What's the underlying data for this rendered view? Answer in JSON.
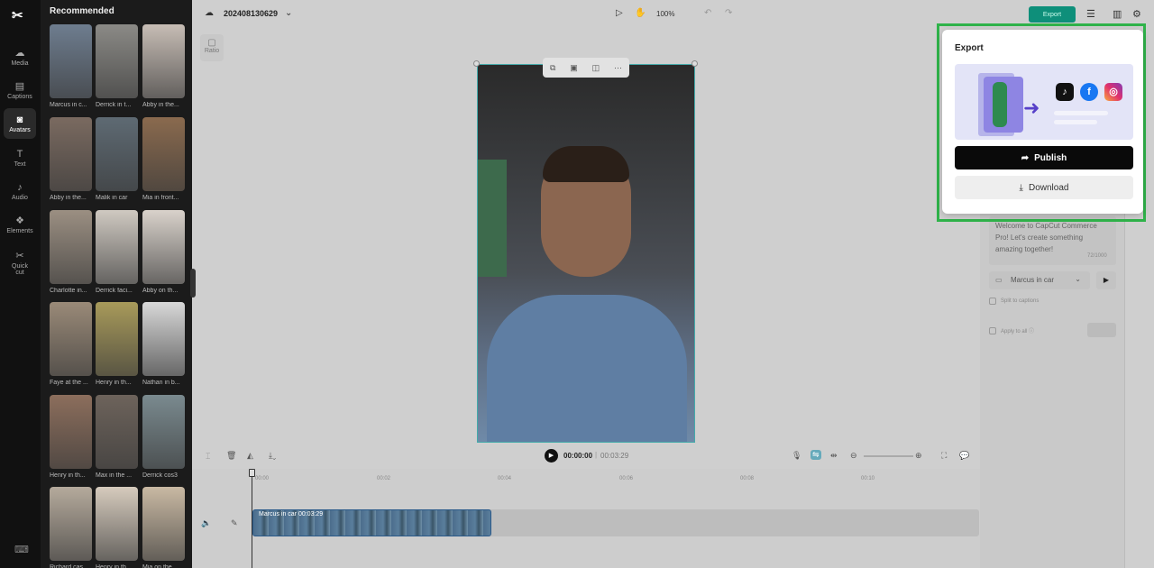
{
  "app": {
    "logo": "✂"
  },
  "rail": {
    "items": [
      {
        "label": "Media",
        "icon": "media-icon",
        "glyph": "☁"
      },
      {
        "label": "Captions",
        "icon": "captions-icon",
        "glyph": "▤"
      },
      {
        "label": "Avatars",
        "icon": "avatars-icon",
        "glyph": "◙"
      },
      {
        "label": "Text",
        "icon": "text-icon",
        "glyph": "T"
      },
      {
        "label": "Audio",
        "icon": "audio-icon",
        "glyph": "♪"
      },
      {
        "label": "Elements",
        "icon": "elements-icon",
        "glyph": "❖"
      },
      {
        "label": "Quick cut",
        "icon": "quick-cut-icon",
        "glyph": "✂"
      }
    ]
  },
  "panel": {
    "title": "Recommended",
    "avatars": [
      {
        "label": "Marcus in c...",
        "color": "#6e7d8f"
      },
      {
        "label": "Derrick in t...",
        "color": "#8b8a86"
      },
      {
        "label": "Abby in the...",
        "color": "#c7bdb5"
      },
      {
        "label": "Abby in the...",
        "color": "#7a6a60"
      },
      {
        "label": "Malik in car",
        "color": "#5e6a73"
      },
      {
        "label": "Mia in front...",
        "color": "#8a6a4e"
      },
      {
        "label": "Charlotte in...",
        "color": "#9b8f82"
      },
      {
        "label": "Derrick faci...",
        "color": "#cfc9c1"
      },
      {
        "label": "Abby on th...",
        "color": "#d9d2cb"
      },
      {
        "label": "Faye at the ...",
        "color": "#9a8a78"
      },
      {
        "label": "Henry in th...",
        "color": "#a89a5a"
      },
      {
        "label": "Nathan in b...",
        "color": "#d8d8d8"
      },
      {
        "label": "Henry in th...",
        "color": "#8c6e5c"
      },
      {
        "label": "Max in the ...",
        "color": "#6d635b"
      },
      {
        "label": "Derrick cos3",
        "color": "#7a8a8f"
      },
      {
        "label": "Richard cas...",
        "color": "#b5aa9c"
      },
      {
        "label": "Henry in th...",
        "color": "#d6cbbd"
      },
      {
        "label": "Mia on the...",
        "color": "#c9b9a3"
      }
    ]
  },
  "topbar": {
    "project_name": "202408130629",
    "zoom": "100%",
    "export_label": "Export"
  },
  "canvas": {
    "ratio_label": "Ratio"
  },
  "right_panel": {
    "script_text": "Welcome to CapCut Commerce Pro! Let's create something amazing together!",
    "script_count": "72/1000",
    "voice": "Marcus in car",
    "split_label": "Split to captions",
    "apply_label": "Apply to all ⓘ"
  },
  "timeline": {
    "current_time": "00:00:00",
    "total_time": "00:03:29",
    "ruler": [
      "00:00",
      "00:02",
      "00:04",
      "00:06",
      "00:08",
      "00:10"
    ],
    "clip_label": "Marcus in car   00:03:29"
  },
  "export_popup": {
    "title": "Export",
    "publish_label": "Publish",
    "download_label": "Download",
    "social": [
      "tiktok-icon",
      "facebook-icon",
      "instagram-icon"
    ]
  }
}
